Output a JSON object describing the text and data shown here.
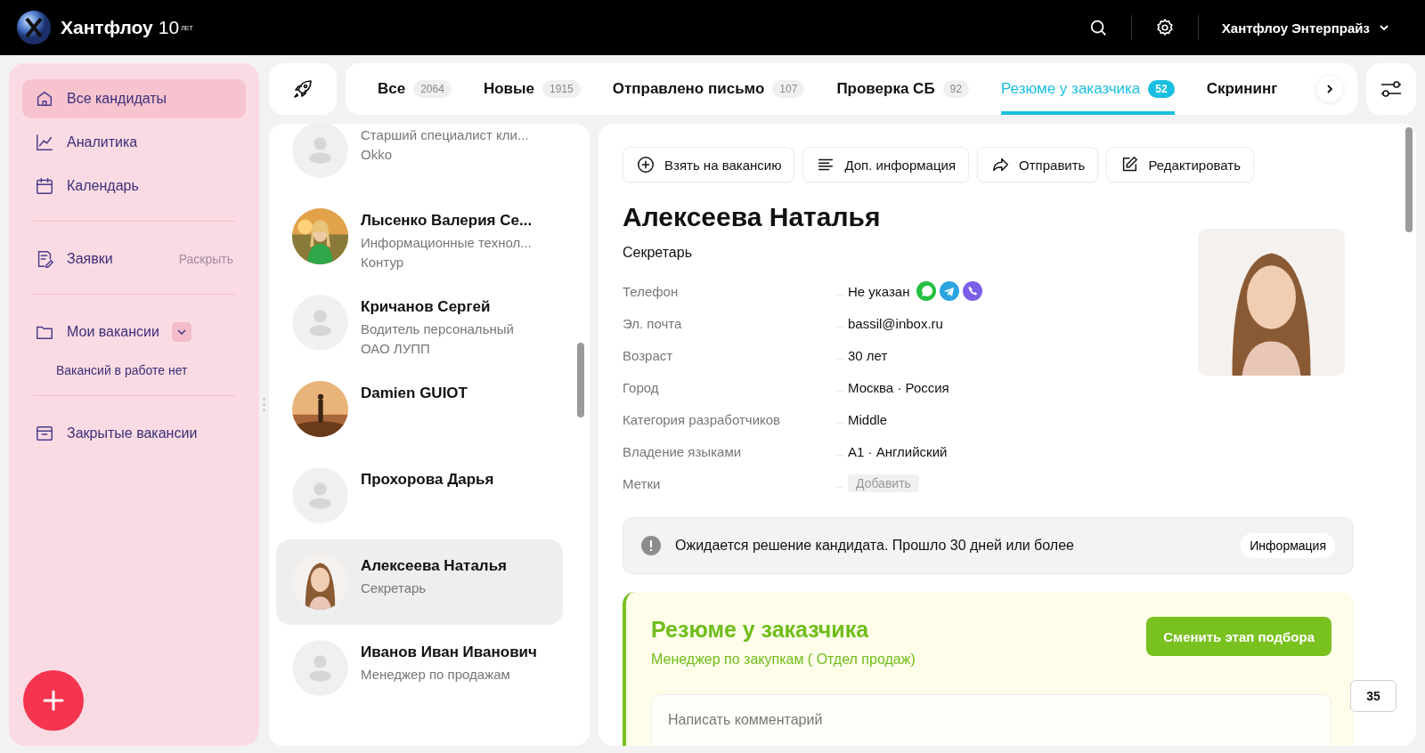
{
  "header": {
    "brand": "Хантфлоу",
    "anniversary": "10",
    "anniversary_sub": "ЛЕТ",
    "account": "Хантфлоу Энтерпрайз"
  },
  "sidebar": {
    "items": [
      {
        "kind": "link",
        "label": "Все кандидаты",
        "selected": true
      },
      {
        "kind": "link",
        "label": "Аналитика",
        "selected": false
      },
      {
        "kind": "link",
        "label": "Календарь",
        "selected": false
      },
      {
        "kind": "divider"
      },
      {
        "kind": "expand",
        "label": "Заявки",
        "action": "Раскрыть",
        "selected": false
      },
      {
        "kind": "divider"
      },
      {
        "kind": "dropdown",
        "label": "Мои вакансии",
        "selected": false
      },
      {
        "kind": "note",
        "label": "Вакансий в работе нет"
      },
      {
        "kind": "divider"
      },
      {
        "kind": "link",
        "label": "Закрытые вакансии",
        "selected": false
      }
    ]
  },
  "tabs": [
    {
      "label": "Все",
      "count": "2064",
      "selected": false
    },
    {
      "label": "Новые",
      "count": "1915",
      "selected": false
    },
    {
      "label": "Отправлено письмо",
      "count": "107",
      "selected": false
    },
    {
      "label": "Проверка СБ",
      "count": "92",
      "selected": false
    },
    {
      "label": "Резюме у заказчика",
      "count": "52",
      "selected": true
    },
    {
      "label": "Скрининг",
      "selected": false
    }
  ],
  "candidates": [
    {
      "kind": "no-photo",
      "lines": [
        "Старший специалист кли...",
        "Okko"
      ],
      "selected": false
    },
    {
      "name": "Лысенко Валерия Се...",
      "lines": [
        "Информационные технол...",
        "Контур"
      ],
      "selected": false
    },
    {
      "kind": "no-photo",
      "name": "Кричанов Сергей",
      "lines": [
        "Водитель персональный",
        "ОАО ЛУПП"
      ],
      "selected": false
    },
    {
      "name": "Damien GUIOT",
      "selected": false
    },
    {
      "kind": "no-photo",
      "name": "Прохорова Дарья",
      "selected": false
    },
    {
      "name": "Алексеева Наталья",
      "lines": [
        "Секретарь"
      ],
      "selected": true
    },
    {
      "kind": "no-photo",
      "name": "Иванов Иван Иванович",
      "lines": [
        "Менеджер по продажам"
      ],
      "selected": false
    }
  ],
  "actions": [
    {
      "label": "Взять на вакансию"
    },
    {
      "label": "Доп. информация"
    },
    {
      "label": "Отправить"
    },
    {
      "label": "Редактировать"
    }
  ],
  "profile": {
    "name": "Алексеева Наталья",
    "position": "Секретарь",
    "fields": [
      {
        "label": "Телефон",
        "value": "Не указан",
        "kind": "phone"
      },
      {
        "label": "Эл. почта",
        "value": "bassil@inbox.ru",
        "kind": "text"
      },
      {
        "label": "Возраст",
        "value": "30 лет",
        "kind": "text"
      },
      {
        "label": "Город",
        "value": "Москва · Россия",
        "kind": "text"
      },
      {
        "label": "Категория разработчиков",
        "value": "Middle",
        "kind": "text"
      },
      {
        "label": "Владение языками",
        "value": "A1 · Английский",
        "kind": "text"
      },
      {
        "label": "Метки",
        "value": "Добавить",
        "kind": "tag-button"
      }
    ]
  },
  "notice": {
    "text": "Ожидается решение кандидата. Прошло 30 дней или более",
    "button": "Информация"
  },
  "stage": {
    "title": "Резюме у заказчика",
    "subtitle": "Менеджер по закупкам ( Отдел продаж)",
    "button": "Сменить этап подбора",
    "comment_placeholder": "Написать комментарий"
  },
  "chat_badge": "35"
}
